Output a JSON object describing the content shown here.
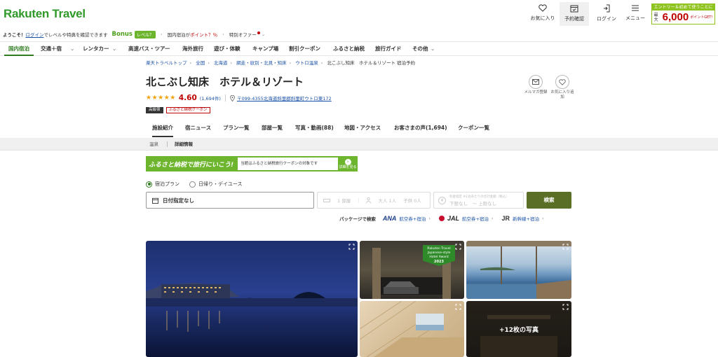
{
  "brand": {
    "logo": "Rakuten Travel"
  },
  "header": {
    "favorites": "お気に入り",
    "reservations": "予約確認",
    "login": "ログイン",
    "menu": "メニュー",
    "promo": {
      "top": "エントリー＆初めて使うことに",
      "prefix": "最大",
      "amount": "6,000",
      "suffix": "ポイントGET!"
    }
  },
  "welcome": {
    "greeting": "ようこそ！",
    "login_link": "ログイン",
    "level_text": "でレベルや特典を確認できます",
    "bonus_label": "Bonus",
    "bonus_badge": "レベル？",
    "domestic_points": "国内宿泊が",
    "points_percent": "ポイント？％",
    "special_offers": "特別オファー"
  },
  "mainnav": [
    "国内宿泊",
    "交通＋宿",
    "レンタカー",
    "高速バス・ツアー",
    "海外旅行",
    "遊び・体験",
    "キャンプ場",
    "割引クーポン",
    "ふるさと納税",
    "旅行ガイド",
    "その他"
  ],
  "breadcrumb": {
    "links": [
      "楽天トラベルトップ",
      "全国",
      "北海道",
      "網走・紋別・北見・知床",
      "ウトロ温泉"
    ],
    "current": "北こぶし知床　ホテル＆リゾート 宿泊予約"
  },
  "hotel": {
    "name": "北こぶし知床　ホテル＆リゾート",
    "stars": "★★★★★",
    "score": "4.60",
    "review_count": "(1,694件)",
    "address": "〒099-4355北海道斜里郡斜里町ウトロ東172",
    "tag_premium": "高級宿",
    "tag_furusato": "ふるさと納税クーポン",
    "rating_value": 4.6
  },
  "actions": {
    "email": "メルマガ登録",
    "favorite": "お気に入り追加"
  },
  "tabs": [
    "施設紹介",
    "宿ニュース",
    "プラン一覧",
    "部屋一覧",
    "写真・動画(88)",
    "地図・アクセス",
    "お客さまの声(1,694)",
    "クーポン一覧"
  ],
  "subtabs": [
    "温泉",
    "詳細情報"
  ],
  "banner": {
    "left": "ふるさと納税で旅行にいこう!",
    "right": "当館はふるさと納税旅行クーポンの対象です",
    "button": "詳細を見る"
  },
  "search": {
    "radio_stay": "宿泊プラン",
    "radio_day": "日帰り・デイユース",
    "date": "日付指定なし",
    "rooms": "1 部屋",
    "adults": "大人 1人",
    "children": "子供 0人",
    "price_note": "料金指定 ※1泊あたりの合計金額（税込）",
    "price_min": "下限なし",
    "price_max": "〜 上限なし",
    "button": "検索"
  },
  "packages": {
    "label": "パッケージで検索",
    "ana_logo": "ANA",
    "ana_text": "航空券+宿泊",
    "jal_logo": "JAL",
    "jal_text": "航空券+宿泊",
    "jr_logo": "JR",
    "jr_text": "新幹線+宿泊"
  },
  "photos": {
    "more": "+12枚の写真",
    "award_title": "Rakuten Travel Japanese-style Hotel Award",
    "award_year": "2023"
  },
  "colors": {
    "brand_green": "#2f9a2a",
    "accent_red": "#bf0000",
    "search_button": "#5a6e26",
    "link_blue": "#1a52a8",
    "star": "#f3a20e"
  }
}
